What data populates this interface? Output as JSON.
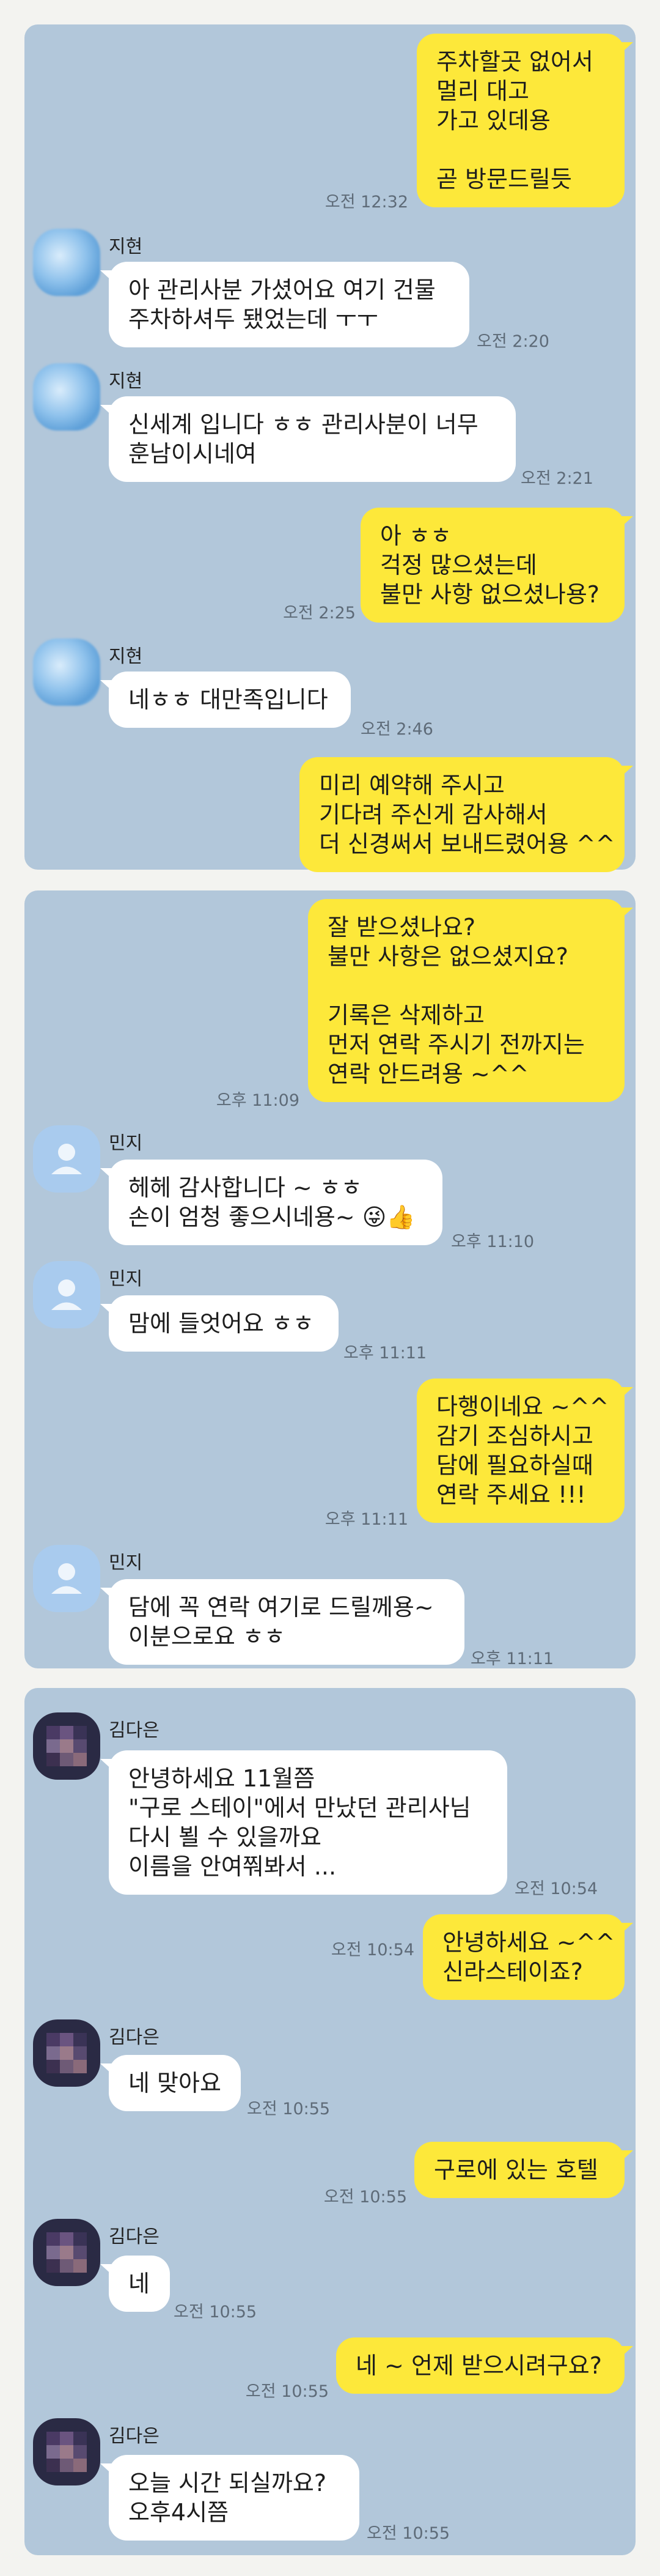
{
  "panels": [
    {
      "messages": [
        {
          "type": "out",
          "text": "주차할곳 없어서\n멀리 대고\n가고 있데용\n\n곧 방문드릴듯",
          "time": "오전 12:32"
        },
        {
          "type": "in",
          "sender": "지현",
          "text": "아 관리사분 가셨어요 여기 건물\n주차하셔두 됐었는데 ㅜㅜ",
          "time": "오전 2:20"
        },
        {
          "type": "in",
          "sender": "지현",
          "text": "신세계 입니다 ㅎㅎ 관리사분이 너무\n훈남이시네여",
          "time": "오전 2:21"
        },
        {
          "type": "out",
          "text": "아 ㅎㅎ\n걱정 많으셨는데\n불만 사항 없으셨나용?",
          "time": "오전 2:25"
        },
        {
          "type": "in",
          "sender": "지현",
          "text": "네ㅎㅎ 대만족입니다",
          "time": "오전 2:46"
        },
        {
          "type": "out",
          "text": "미리 예약해 주시고\n기다려 주신게 감사해서\n더 신경써서 보내드렸어용 ^^",
          "time": ""
        }
      ]
    },
    {
      "messages": [
        {
          "type": "out",
          "text": "잘 받으셨나요?\n불만 사항은 없으셨지요?\n\n기록은 삭제하고\n먼저 연락 주시기 전까지는\n연락 안드려용 ~^^",
          "time": "오후 11:09"
        },
        {
          "type": "in",
          "sender": "민지",
          "text": "헤헤 감사합니다 ~ ㅎㅎ\n손이 엄청 좋으시네용~ 😜👍",
          "time": "오후 11:10"
        },
        {
          "type": "in",
          "sender": "민지",
          "text": "맘에 들엇어요 ㅎㅎ",
          "time": "오후 11:11"
        },
        {
          "type": "out",
          "text": "다행이네요 ~^^\n감기 조심하시고\n담에 필요하실때\n연락 주세요 !!!",
          "time": "오후 11:11"
        },
        {
          "type": "in",
          "sender": "민지",
          "text": "담에 꼭 연락 여기로 드릴께용~\n이분으로요 ㅎㅎ",
          "time": "오후 11:11"
        }
      ]
    },
    {
      "messages": [
        {
          "type": "in",
          "sender": "김다은",
          "text": "안녕하세요 11월쯤\n\"구로 스테이\"에서 만났던 관리사님\n다시 뵐 수 있을까요\n이름을 안여쭤봐서 ...",
          "time": "오전 10:54"
        },
        {
          "type": "out",
          "text": "안녕하세요 ~^^\n신라스테이죠?",
          "time": "오전 10:54"
        },
        {
          "type": "in",
          "sender": "김다은",
          "text": "네 맞아요",
          "time": "오전 10:55"
        },
        {
          "type": "out",
          "text": "구로에 있는 호텔",
          "time": "오전 10:55"
        },
        {
          "type": "in",
          "sender": "김다은",
          "text": "네",
          "time": "오전 10:55"
        },
        {
          "type": "out",
          "text": "네 ~ 언제 받으시려구요?",
          "time": "오전 10:55"
        },
        {
          "type": "in",
          "sender": "김다은",
          "text": "오늘 시간 되실까요?\n오후4시쯤",
          "time": "오전 10:55"
        }
      ]
    }
  ],
  "colors": {
    "outgoing": "#fde83a",
    "incoming": "#ffffff",
    "panel": "#b2c7da"
  }
}
